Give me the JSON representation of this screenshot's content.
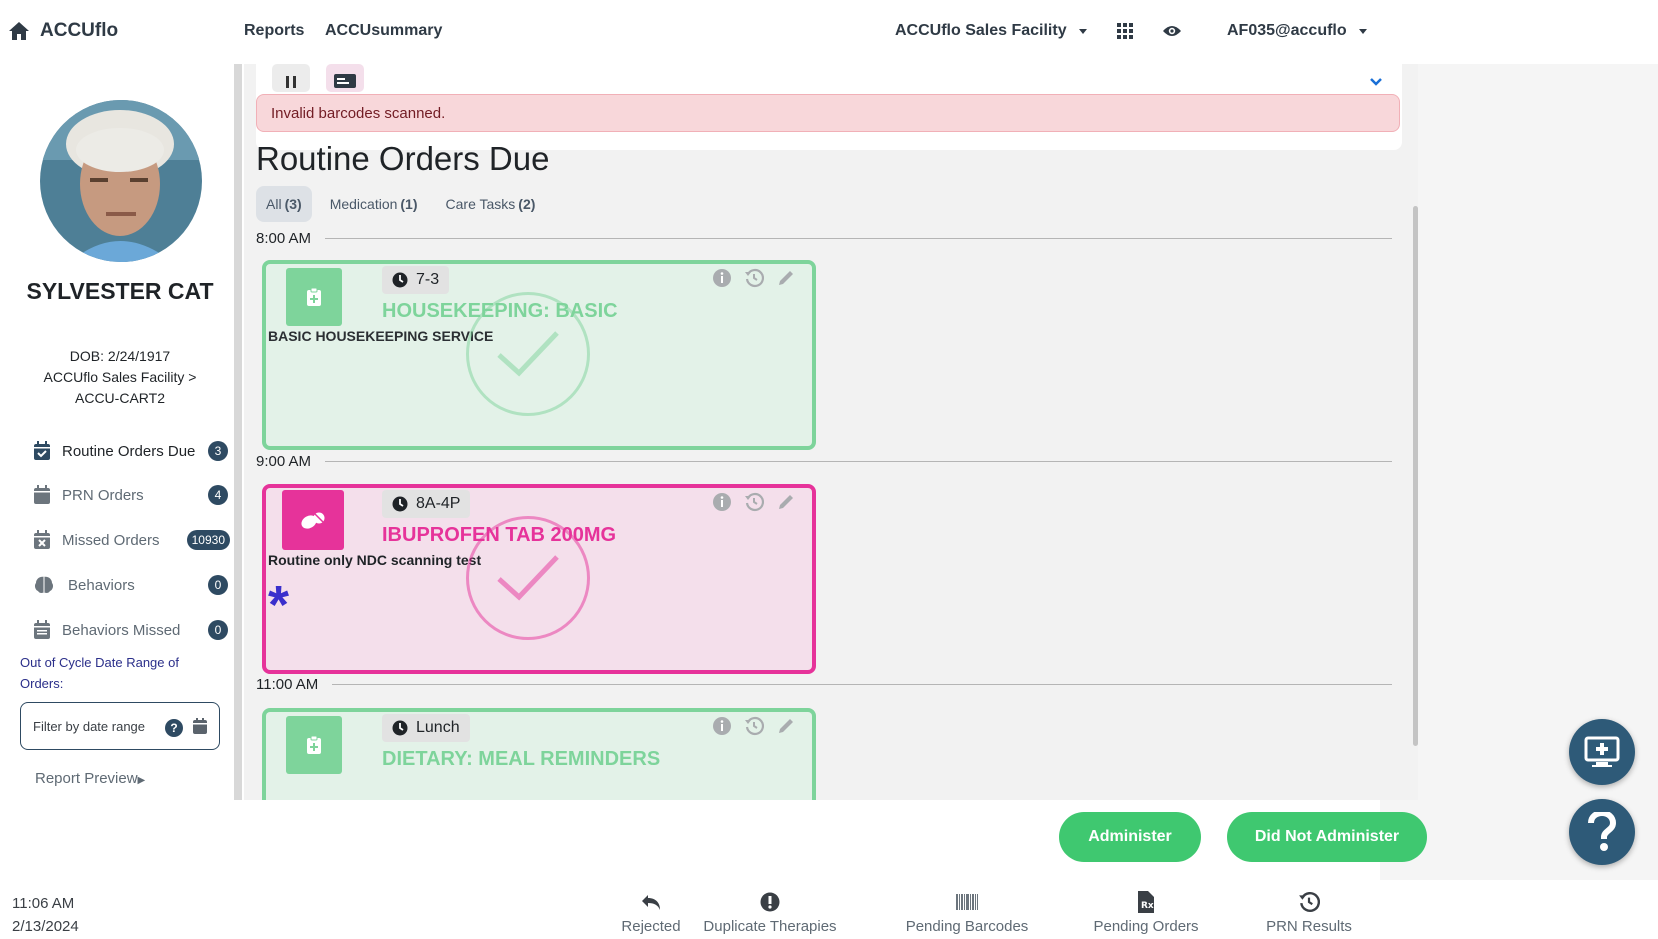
{
  "header": {
    "brand": "ACCUflo",
    "nav_reports": "Reports",
    "nav_summary": "ACCUsummary",
    "facility": "ACCUflo Sales Facility",
    "user": "AF035@accuflo"
  },
  "patient": {
    "name": "SYLVESTER CAT",
    "dob": "DOB: 2/24/1917",
    "location": "ACCUflo Sales Facility > ACCU-CART2"
  },
  "sidebar": {
    "items": [
      {
        "label": "Routine Orders Due",
        "count": "3"
      },
      {
        "label": "PRN Orders",
        "count": "4"
      },
      {
        "label": "Missed Orders",
        "count": "10930"
      },
      {
        "label": "Behaviors",
        "count": "0"
      },
      {
        "label": "Behaviors Missed",
        "count": "0"
      }
    ],
    "cycle_label": "Out of Cycle Date Range of Orders:",
    "filter_placeholder": "Filter by date range",
    "help": "?",
    "report_preview": "Report Preview"
  },
  "main": {
    "alert": "Invalid barcodes scanned.",
    "title": "Routine Orders Due",
    "tabs": [
      {
        "label": "All",
        "count": "(3)"
      },
      {
        "label": "Medication",
        "count": "(1)"
      },
      {
        "label": "Care Tasks",
        "count": "(2)"
      }
    ],
    "groups": [
      {
        "time": "8:00 AM",
        "chip": "7-3",
        "name": "HOUSEKEEPING: BASIC",
        "desc": "BASIC HOUSEKEEPING SERVICE"
      },
      {
        "time": "9:00 AM",
        "chip": "8A-4P",
        "name": "IBUPROFEN TAB 200MG",
        "desc": "Routine only NDC scanning test"
      },
      {
        "time": "11:00 AM",
        "chip": "Lunch",
        "name": "DIETARY: MEAL REMINDERS",
        "desc": ""
      }
    ]
  },
  "actions": {
    "administer": "Administer",
    "did_not_administer": "Did Not Administer"
  },
  "footer": {
    "time": "11:06 AM",
    "date": "2/13/2024",
    "items": [
      "Rejected",
      "Duplicate Therapies",
      "Pending Barcodes",
      "Pending Orders",
      "PRN Results"
    ]
  },
  "colors": {
    "care_task": "#7ed49b",
    "medication": "#e6339a",
    "primary": "#2e4a62",
    "action_green": "#3fc870"
  },
  "icons": [
    "home-icon",
    "grid-icon",
    "eye-icon",
    "calendar-check-icon",
    "calendar-icon",
    "calendar-x-icon",
    "brain-icon",
    "clipboard-plus-icon",
    "pills-icon",
    "clock-icon",
    "info-icon",
    "history-icon",
    "pencil-icon",
    "check-icon",
    "undo-icon",
    "exclamation-icon",
    "barcode-icon",
    "rx-file-icon",
    "monitor-plus-icon",
    "question-icon"
  ]
}
